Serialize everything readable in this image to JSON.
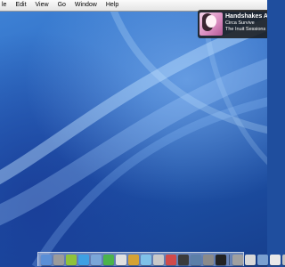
{
  "menubar": {
    "items": [
      "le",
      "Edit",
      "View",
      "Go",
      "Window",
      "Help"
    ]
  },
  "notification": {
    "title": "Handshakes At",
    "artist": "Circa Survive",
    "album": "The Inuit Sessions ("
  },
  "dock": {
    "icons": [
      {
        "name": "finder-icon",
        "color": "#5b8fd6"
      },
      {
        "name": "automator-icon",
        "color": "#9b9b9b"
      },
      {
        "name": "android-icon",
        "color": "#8fc23a"
      },
      {
        "name": "safari-icon",
        "color": "#3ea0e3"
      },
      {
        "name": "network-icon",
        "color": "#7aa6d8"
      },
      {
        "name": "chat-icon",
        "color": "#4bb34b"
      },
      {
        "name": "text-editor-icon",
        "color": "#e0e0e0"
      },
      {
        "name": "pen-icon",
        "color": "#d4a235"
      },
      {
        "name": "itunes-icon",
        "color": "#7fc1e8"
      },
      {
        "name": "phone-icon",
        "color": "#c9c9c9"
      },
      {
        "name": "game-icon",
        "color": "#d04a4a"
      },
      {
        "name": "film-icon",
        "color": "#3b3b3b"
      },
      {
        "name": "photo-icon",
        "color": "#5c7fa8"
      },
      {
        "name": "tools-icon",
        "color": "#8a8a8a"
      },
      {
        "name": "terminal-icon",
        "color": "#222222"
      },
      {
        "name": "preferences-icon",
        "color": "#a0a0a0"
      },
      {
        "name": "window-icon",
        "color": "#d8d8d8"
      },
      {
        "name": "folder-icon",
        "color": "#7aa0d0"
      },
      {
        "name": "document-icon",
        "color": "#e8e8e8"
      },
      {
        "name": "trash-icon",
        "color": "#c0c0c0"
      }
    ]
  }
}
